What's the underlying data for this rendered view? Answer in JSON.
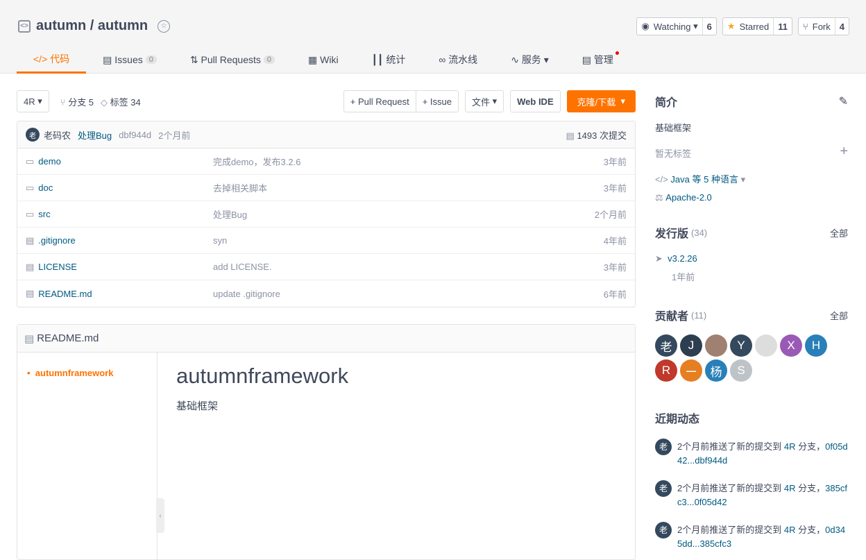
{
  "repo": {
    "title": "autumn / autumn"
  },
  "actions": [
    {
      "label": "Watching",
      "count": "6",
      "icon": "eye-icon"
    },
    {
      "label": "Starred",
      "count": "11",
      "icon": "star-icon"
    },
    {
      "label": "Fork",
      "count": "4",
      "icon": "fork-icon"
    }
  ],
  "tabs": [
    {
      "label": "代码",
      "icon": "code-icon"
    },
    {
      "label": "Issues",
      "count": "0",
      "icon": "issues-icon"
    },
    {
      "label": "Pull Requests",
      "count": "0",
      "icon": "pr-icon"
    },
    {
      "label": "Wiki",
      "icon": "book-icon"
    },
    {
      "label": "统计",
      "icon": "chart-icon"
    },
    {
      "label": "流水线",
      "icon": "pipeline-icon"
    },
    {
      "label": "服务",
      "icon": "pulse-icon"
    },
    {
      "label": "管理",
      "icon": "settings-icon"
    }
  ],
  "toolbar": {
    "branch": "4R",
    "branches": "分支 5",
    "tags": "标签 34",
    "pull_request": "+ Pull Request",
    "issue": "+ Issue",
    "file": "文件",
    "web_ide": "Web IDE",
    "clone": "克隆/下载"
  },
  "commit": {
    "avatar": "老",
    "author": "老码农",
    "message": "处理Bug",
    "hash": "dbf944d",
    "time": "2个月前",
    "count": "1493 次提交"
  },
  "files": [
    {
      "name": "demo",
      "type": "folder",
      "message": "完成demo，发布3.2.6",
      "time": "3年前"
    },
    {
      "name": "doc",
      "type": "folder",
      "message": "去掉相关脚本",
      "time": "3年前"
    },
    {
      "name": "src",
      "type": "folder",
      "message": "处理Bug",
      "time": "2个月前"
    },
    {
      "name": ".gitignore",
      "type": "file",
      "message": "syn",
      "time": "4年前"
    },
    {
      "name": "LICENSE",
      "type": "file",
      "message": "add LICENSE.",
      "time": "3年前"
    },
    {
      "name": "README.md",
      "type": "file",
      "message": "update .gitignore",
      "time": "6年前"
    }
  ],
  "readme": {
    "filename": "README.md",
    "toc": "autumnframework",
    "heading": "autumnframework",
    "text": "基础框架"
  },
  "sidebar": {
    "intro_title": "简介",
    "description": "基础框架",
    "no_tags": "暂无标签",
    "language": "Java 等 5 种语言",
    "license": "Apache-2.0",
    "releases_title": "发行版",
    "releases_count": "(34)",
    "all": "全部",
    "release_tag": "v3.2.26",
    "release_time": "1年前",
    "contributors_title": "贡献者",
    "contributors_count": "(11)",
    "contributors": [
      {
        "t": "老",
        "c": "#34495e"
      },
      {
        "t": "J",
        "c": "#2c3e50"
      },
      {
        "t": "",
        "c": "#a08070"
      },
      {
        "t": "Y",
        "c": "#34495e"
      },
      {
        "t": "",
        "c": "#dddddd"
      },
      {
        "t": "X",
        "c": "#9b59b6"
      },
      {
        "t": "H",
        "c": "#2980b9"
      },
      {
        "t": "R",
        "c": "#c0392b"
      },
      {
        "t": "ー",
        "c": "#e67e22"
      },
      {
        "t": "杨",
        "c": "#2980b9"
      },
      {
        "t": "S",
        "c": "#bdc3c7"
      }
    ],
    "activity_title": "近期动态",
    "activity": [
      {
        "avatar": "老",
        "text": "2个月前推送了新的提交到",
        "branch": "4R",
        "suffix": "分支，",
        "range": "0f05d42...dbf944d"
      },
      {
        "avatar": "老",
        "text": "2个月前推送了新的提交到",
        "branch": "4R",
        "suffix": "分支，",
        "range": "385cfc3...0f05d42"
      },
      {
        "avatar": "老",
        "text": "2个月前推送了新的提交到",
        "branch": "4R",
        "suffix": "分支，",
        "range": "0d345dd...385cfc3"
      }
    ]
  }
}
